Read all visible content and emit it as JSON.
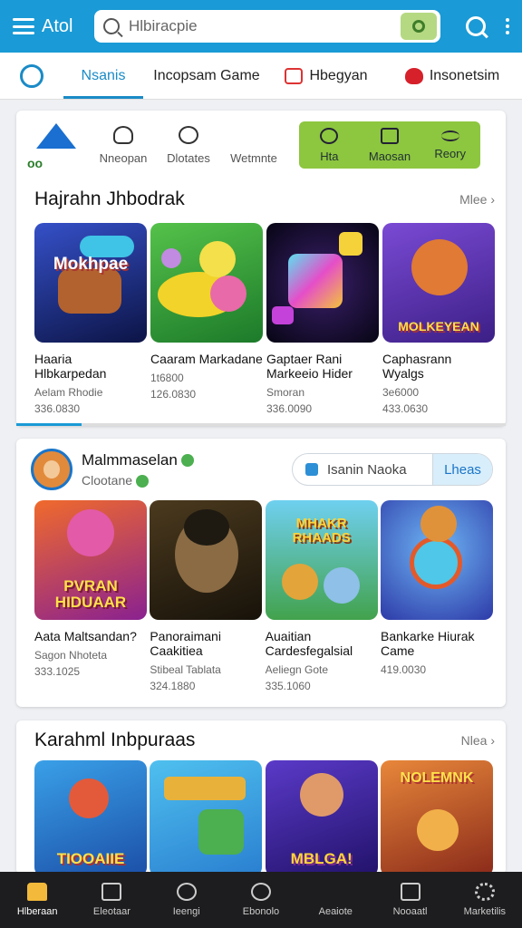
{
  "topbar": {
    "brand": "Atol",
    "search_placeholder": "Hlbiracpie"
  },
  "tabs": [
    {
      "label": ""
    },
    {
      "label": "Nsanis"
    },
    {
      "label": "Incopsam Game"
    },
    {
      "label": "Hbegyan"
    },
    {
      "label": "Insonetsim"
    }
  ],
  "quick_actions": [
    {
      "label": "Nneopan",
      "icon": "bell-icon"
    },
    {
      "label": "Dlotates",
      "icon": "pointer-icon"
    },
    {
      "label": "Wetmnte",
      "icon": "blank-icon"
    }
  ],
  "green_actions": [
    {
      "label": "Hta",
      "icon": "clock-icon"
    },
    {
      "label": "Maosan",
      "icon": "check-icon"
    },
    {
      "label": "Reory",
      "icon": "sliders-icon"
    }
  ],
  "section1": {
    "title": "Hajrahn Jhbodrak",
    "more": "Mlee ›",
    "apps": [
      {
        "name": "Haaria Hlbkarpedan",
        "sub": "Aelam Rhodie",
        "num": "336.0830",
        "art": "Mokhpae",
        "bg": "#2a3a9a"
      },
      {
        "name": "Caaram Markadane",
        "sub": "1t6800",
        "num": "126.0830",
        "art": "",
        "bg": "#3ba34a"
      },
      {
        "name": "Gaptaer Rani Markeeio Hider",
        "sub": "Smoran",
        "num": "336.0090",
        "art": "",
        "bg": "#1a1a3a"
      },
      {
        "name": "Caphasrann Wyalgs",
        "sub": "3e6000",
        "num": "433.0630",
        "art": "MOLKEYEAN",
        "bg": "#5b3aa8"
      }
    ]
  },
  "developer": {
    "name": "Malmmaselan",
    "sub": "Clootane",
    "follow": "Isanin Naoka",
    "button": "Lheas"
  },
  "section2": {
    "apps": [
      {
        "name": "Aata Maltsandan?",
        "sub": "Sagon Nhoteta",
        "num": "333.1025",
        "art": "PVRAN HIDUAAR",
        "bg": "#d6432b"
      },
      {
        "name": "Panoraimani Caakitiea",
        "sub": "Stibeal Tablata",
        "num": "324.1880",
        "art": "",
        "bg": "#2e2416"
      },
      {
        "name": "Auaitian Cardesfegalsial",
        "sub": "Aeliegn Gote",
        "num": "335.1060",
        "art": "MHAKR RHAADS",
        "bg": "#4aa55b"
      },
      {
        "name": "Bankarke Hiurak Came",
        "sub": "",
        "num": "419.0030",
        "art": "",
        "bg": "#2f5fbe"
      }
    ]
  },
  "section3": {
    "title": "Karahml Inbpuraas",
    "more": "Nlea ›",
    "apps": [
      {
        "art": "TIOOAIIE",
        "bg": "#2d7fd3"
      },
      {
        "art": "",
        "bg": "#3da7e0"
      },
      {
        "art": "MBLGA!",
        "bg": "#3b2a9c"
      },
      {
        "art": "NOLEMNK",
        "bg": "#c34a2a"
      }
    ]
  },
  "bottom_nav": [
    {
      "label": "Hlberaan",
      "icon": "home-icon",
      "active": true
    },
    {
      "label": "Eleotaar",
      "icon": "apps-icon",
      "active": false
    },
    {
      "label": "Ieengi",
      "icon": "chat-icon",
      "active": false
    },
    {
      "label": "Ebonolo",
      "icon": "search-icon",
      "active": false
    },
    {
      "label": "Aeaiote",
      "icon": "quote-icon",
      "active": false
    },
    {
      "label": "Nooaatl",
      "icon": "square-icon",
      "active": false
    },
    {
      "label": "Marketilis",
      "icon": "gear-icon",
      "active": false
    }
  ]
}
